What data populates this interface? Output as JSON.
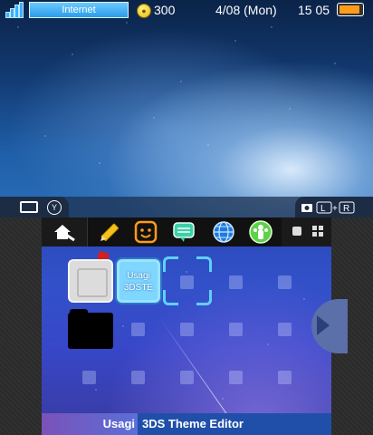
{
  "status": {
    "connection_label": "Internet",
    "coin_count": "300",
    "date": "4/08 (Mon)",
    "time": "15 05",
    "battery_level": 0.9
  },
  "top_controls": {
    "left_hint": "camera-y-icon",
    "right_hint": "camera-l-r-icon"
  },
  "menu_icons": [
    "pencil-icon",
    "face-icon",
    "chat-icon",
    "globe-icon",
    "people-icon"
  ],
  "apps": [
    {
      "name": "sd-card",
      "label": ""
    },
    {
      "name": "usagi-3dste",
      "line1": "Usagi",
      "line2": "3DSTE"
    },
    {
      "name": "folder",
      "label": ""
    }
  ],
  "theme": {
    "author": "Usagi",
    "title": "3DS Theme Editor"
  },
  "colors": {
    "accent": "#39b0ff",
    "battery": "#ff9b1a",
    "title_bar": "#1f4fa8"
  }
}
